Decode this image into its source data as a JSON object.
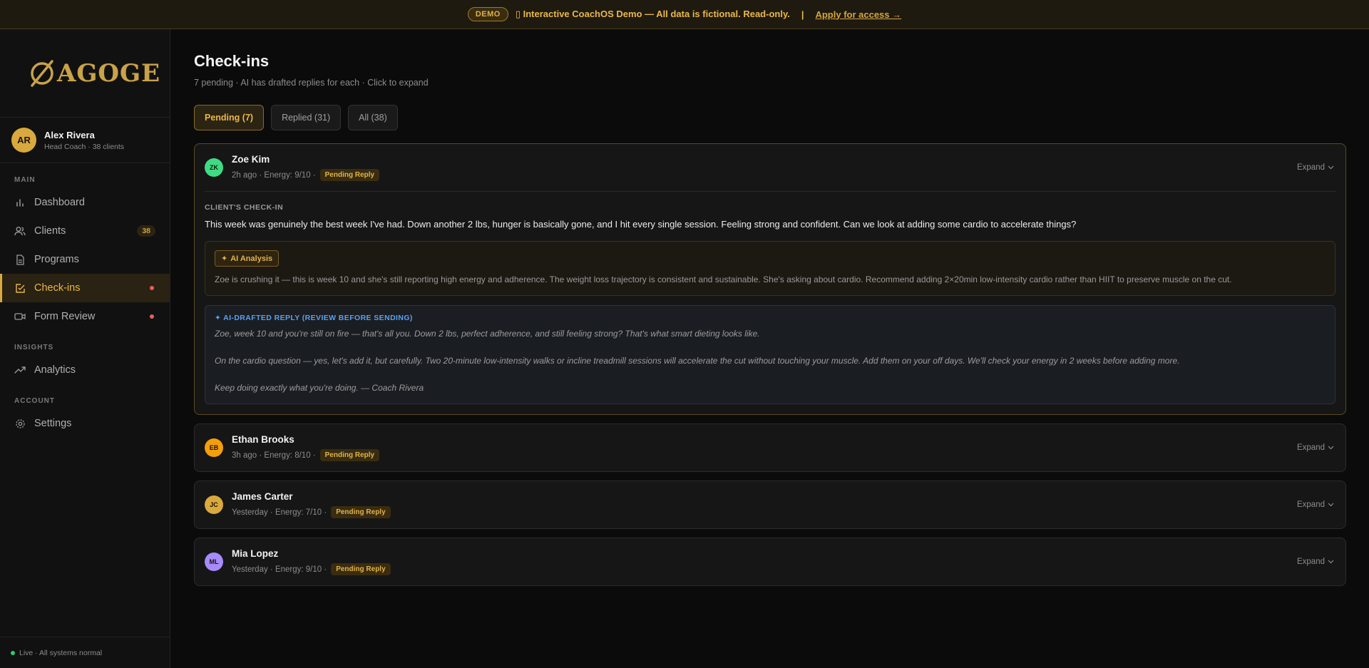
{
  "banner": {
    "badge": "DEMO",
    "text": "▯ Interactive CoachOS Demo — All data is fictional. Read-only.",
    "separator": "|",
    "link": "Apply for access →"
  },
  "brand": {
    "logo_text": "AGOGE"
  },
  "user": {
    "initials": "AR",
    "name": "Alex Rivera",
    "role": "Head Coach · 38 clients"
  },
  "nav": {
    "main_label": "MAIN",
    "insights_label": "INSIGHTS",
    "account_label": "ACCOUNT",
    "dashboard": "Dashboard",
    "clients": "Clients",
    "clients_count": "38",
    "programs": "Programs",
    "checkins": "Check-ins",
    "form_review": "Form Review",
    "analytics": "Analytics",
    "settings": "Settings"
  },
  "footer": {
    "status": "Live · All systems normal"
  },
  "page": {
    "title": "Check-ins",
    "subtitle": "7 pending · AI has drafted replies for each · Click to expand"
  },
  "tabs": {
    "pending": "Pending (7)",
    "replied": "Replied (31)",
    "all": "All (38)"
  },
  "expand_label": "Expand",
  "pending_label": "Pending Reply",
  "checkins": [
    {
      "initials": "ZK",
      "name": "Zoe Kim",
      "meta": "2h ago · Energy: 9/10 ·",
      "avatar_color": "#3ddc84",
      "section_label": "CLIENT'S CHECK-IN",
      "message": "This week was genuinely the best week I've had. Down another 2 lbs, hunger is basically gone, and I hit every single session. Feeling strong and confident. Can we look at adding some cardio to accelerate things?",
      "ai_tag": "AI Analysis",
      "ai_text": "Zoe is crushing it — this is week 10 and she's still reporting high energy and adherence. The weight loss trajectory is consistent and sustainable. She's asking about cardio. Recommend adding 2×20min low-intensity cardio rather than HIIT to preserve muscle on the cut.",
      "draft_label": "✦ AI-DRAFTED REPLY (REVIEW BEFORE SENDING)",
      "draft_p1": "Zoe, week 10 and you're still on fire — that's all you. Down 2 lbs, perfect adherence, and still feeling strong? That's what smart dieting looks like.",
      "draft_p2": "On the cardio question — yes, let's add it, but carefully. Two 20-minute low-intensity walks or incline treadmill sessions will accelerate the cut without touching your muscle. Add them on your off days. We'll check your energy in 2 weeks before adding more.",
      "draft_p3": "Keep doing exactly what you're doing. — Coach Rivera"
    },
    {
      "initials": "EB",
      "name": "Ethan Brooks",
      "meta": "3h ago · Energy: 8/10 ·",
      "avatar_color": "#f59e0b"
    },
    {
      "initials": "JC",
      "name": "James Carter",
      "meta": "Yesterday · Energy: 7/10 ·",
      "avatar_color": "#d9a93e"
    },
    {
      "initials": "ML",
      "name": "Mia Lopez",
      "meta": "Yesterday · Energy: 9/10 ·",
      "avatar_color": "#a78bfa"
    }
  ]
}
